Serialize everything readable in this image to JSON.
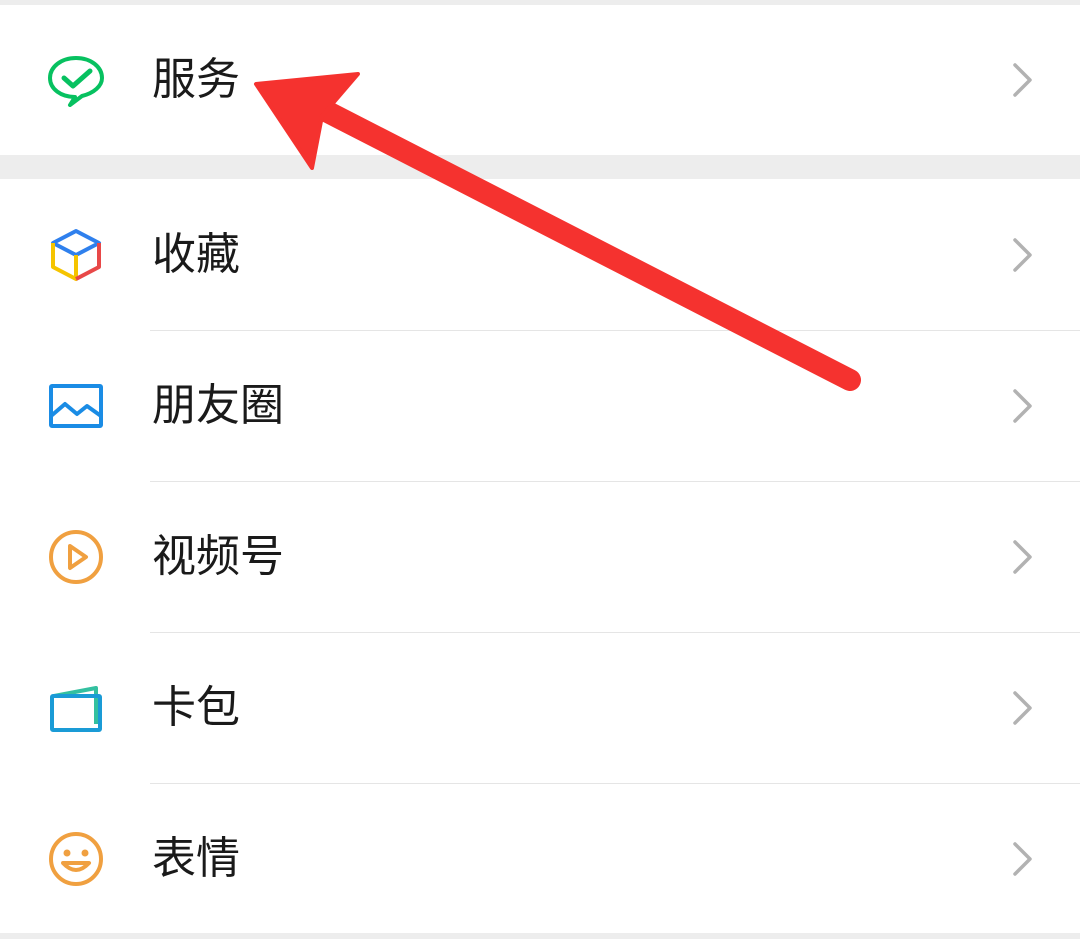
{
  "colors": {
    "page_background": "#ededed",
    "row_background": "#ffffff",
    "text": "#1a1a1a",
    "chevron": "#b2b2b2",
    "divider": "#e5e5e5",
    "annotation_arrow": "#f5322f"
  },
  "services": {
    "label": "服务",
    "icon": "wechat-pay-check-icon",
    "icon_color": "#07c160"
  },
  "menu": {
    "items": [
      {
        "label": "收藏",
        "icon": "favorites-cube-icon"
      },
      {
        "label": "朋友圈",
        "icon": "moments-picture-icon",
        "icon_color": "#1a8ce5"
      },
      {
        "label": "视频号",
        "icon": "channels-play-icon",
        "icon_color": "#f0a040"
      },
      {
        "label": "卡包",
        "icon": "card-wallet-icon",
        "icon_color": "#1a9bd6"
      },
      {
        "label": "表情",
        "icon": "sticker-smile-icon",
        "icon_color": "#f0a040"
      }
    ]
  },
  "annotation": {
    "type": "red-arrow",
    "points_to": "服务"
  }
}
